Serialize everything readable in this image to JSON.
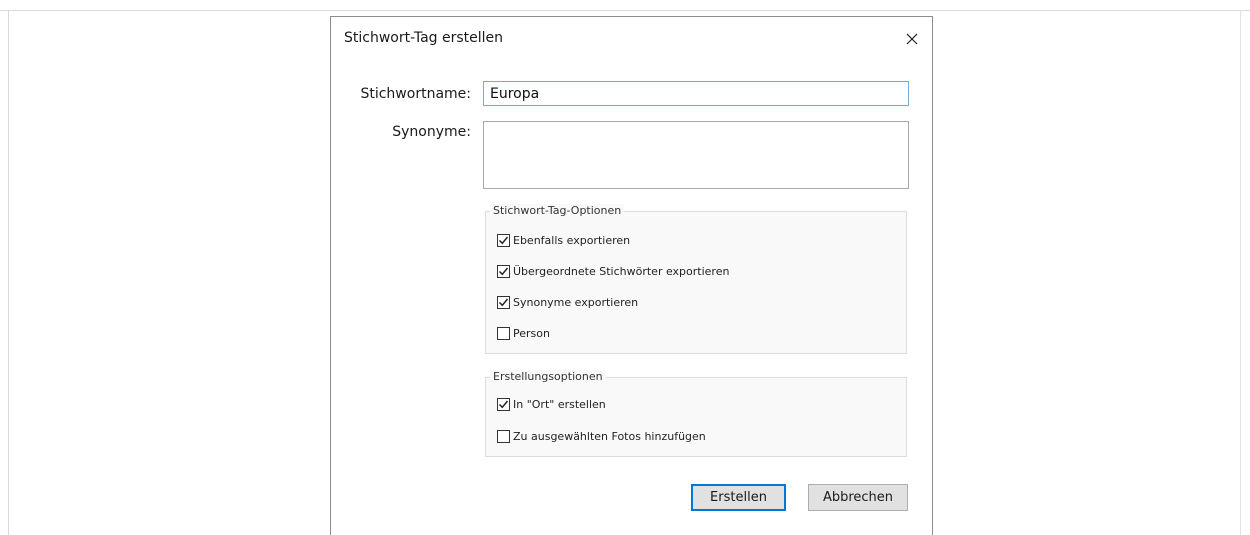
{
  "dialog": {
    "title": "Stichwort-Tag erstellen",
    "close_glyph": "close-icon"
  },
  "form": {
    "name_label": "Stichwortname:",
    "name_value": "Europa",
    "synonyms_label": "Synonyme:",
    "synonyms_value": ""
  },
  "tag_options": {
    "legend": "Stichwort-Tag-Optionen",
    "items": [
      {
        "label": "Ebenfalls exportieren",
        "checked": true
      },
      {
        "label": "Übergeordnete Stichwörter exportieren",
        "checked": true
      },
      {
        "label": "Synonyme exportieren",
        "checked": true
      },
      {
        "label": "Person",
        "checked": false
      }
    ]
  },
  "create_options": {
    "legend": "Erstellungsoptionen",
    "items": [
      {
        "label": "In \"Ort\" erstellen",
        "checked": true
      },
      {
        "label": "Zu ausgewählten Fotos hinzufügen",
        "checked": false
      }
    ]
  },
  "buttons": {
    "create": "Erstellen",
    "cancel": "Abbrechen"
  },
  "colors": {
    "focus_accent": "#0078d7",
    "input_focus_border": "#7aa7d7"
  }
}
